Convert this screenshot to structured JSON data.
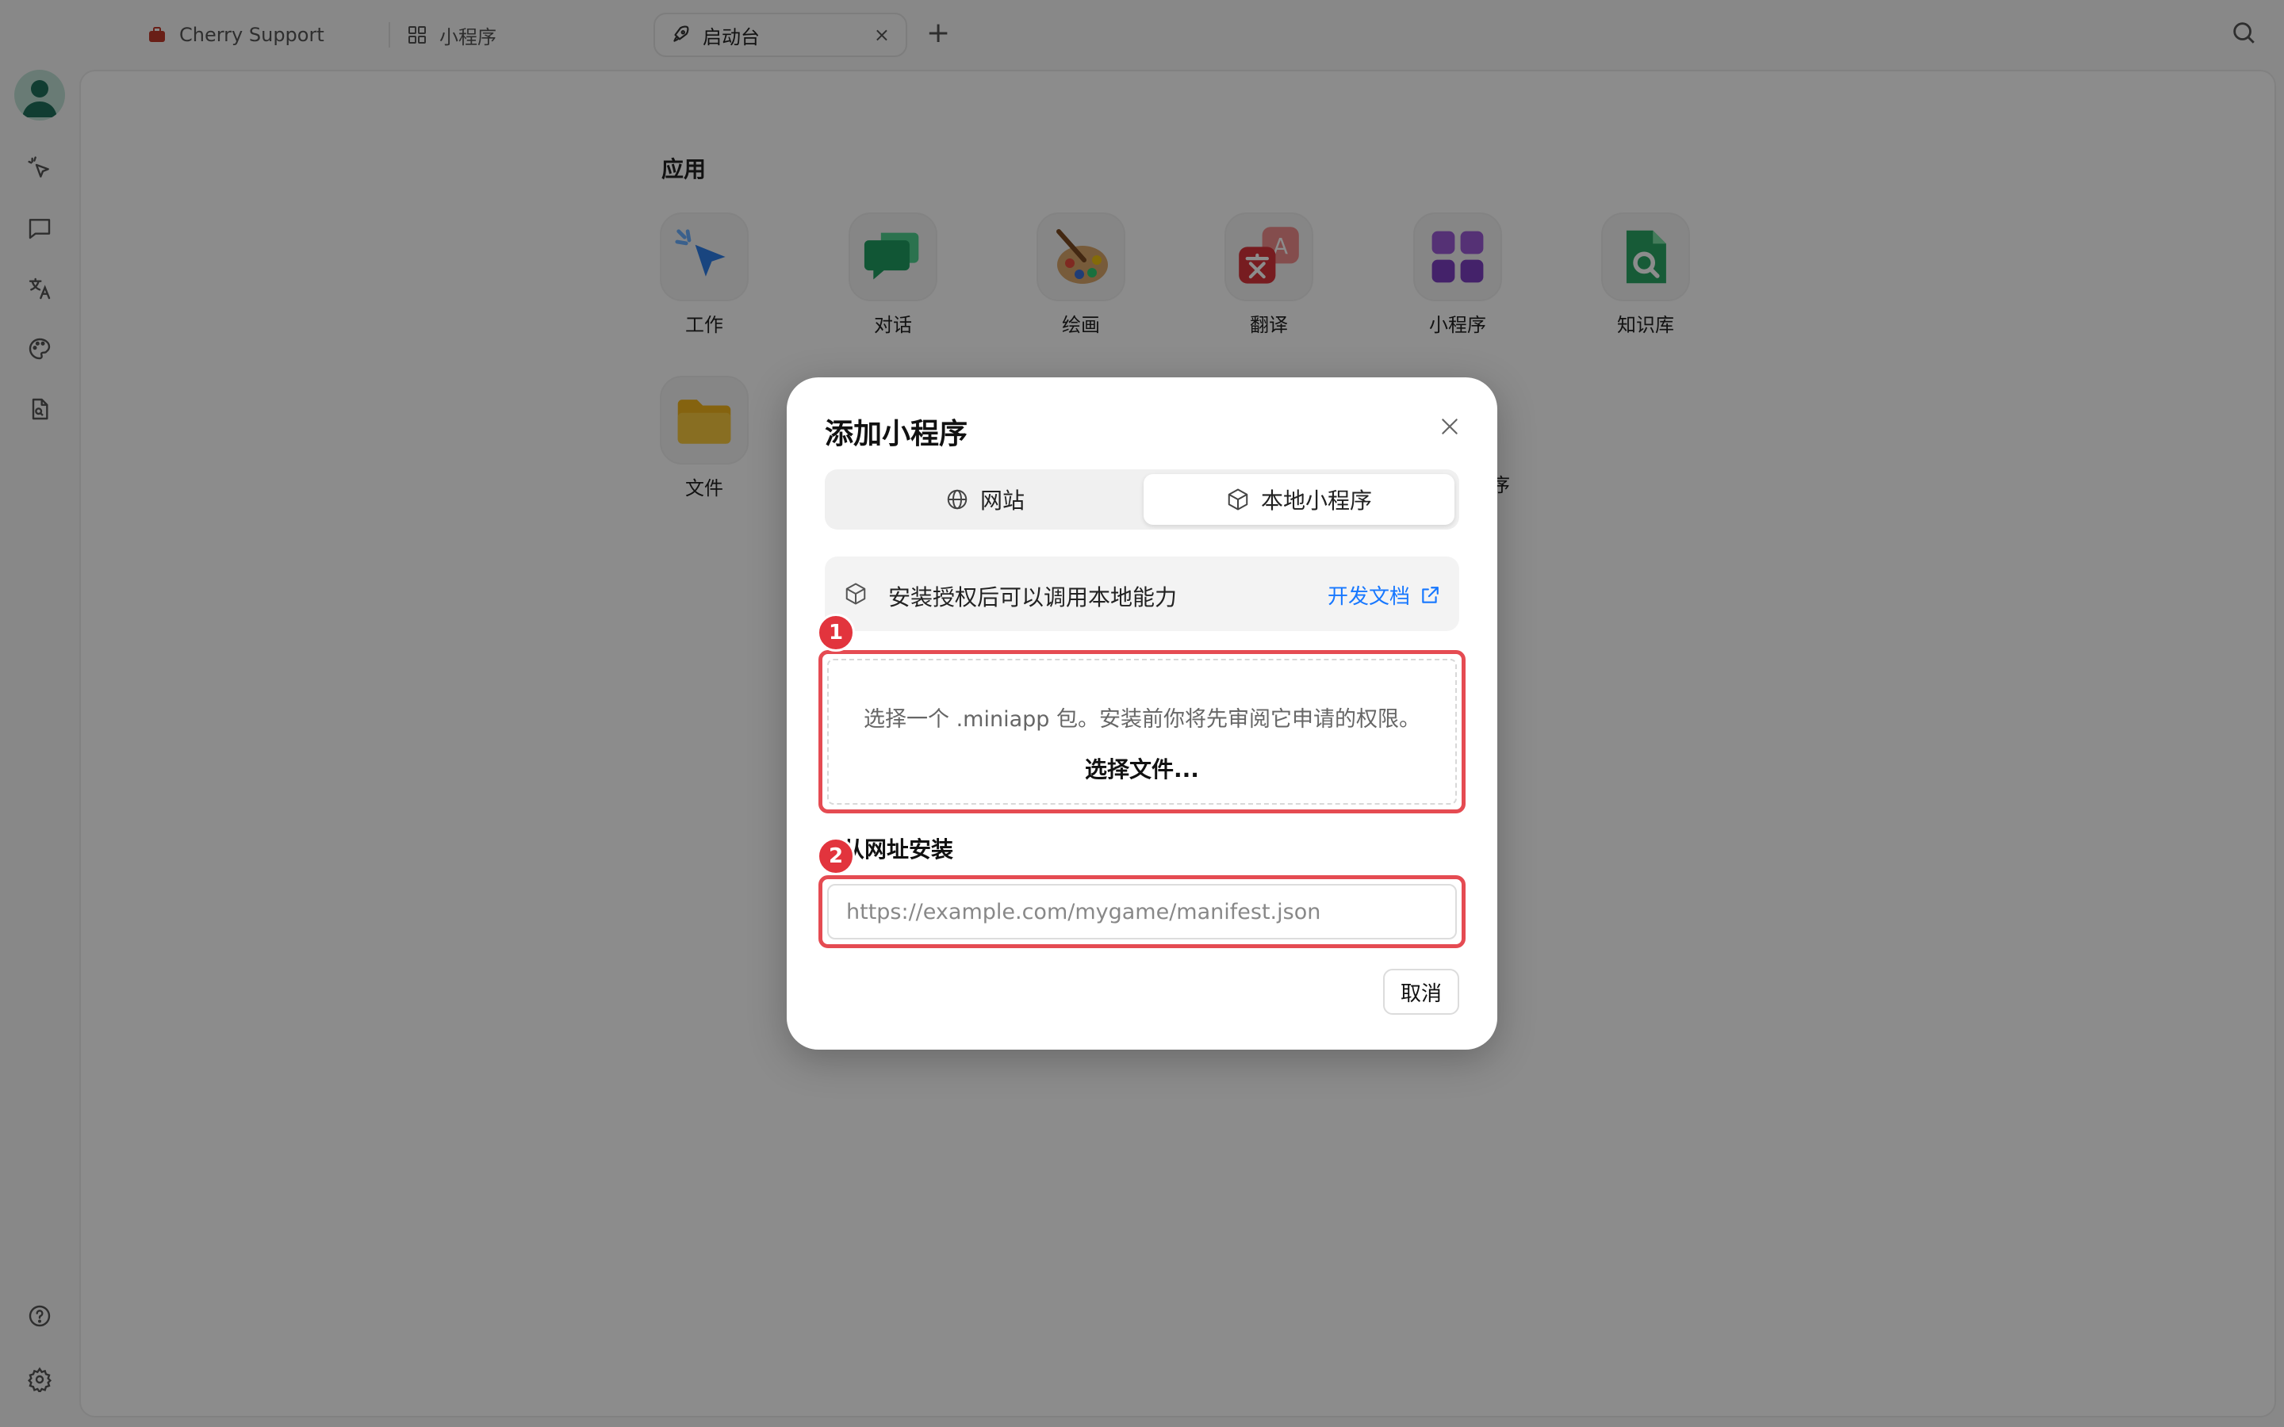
{
  "tabs": [
    {
      "label": "Cherry Support",
      "icon": "briefcase-icon"
    },
    {
      "label": "小程序",
      "icon": "grid-icon"
    },
    {
      "label": "启动台",
      "icon": "rocket-icon",
      "active": true
    }
  ],
  "sidebar": {
    "items": [
      "cursor-sparkle-icon",
      "chat-icon",
      "translate-icon",
      "palette-icon",
      "file-search-icon"
    ],
    "bottom": [
      "help-icon",
      "settings-icon"
    ]
  },
  "launchpad": {
    "section_title": "应用",
    "apps": [
      {
        "label": "工作"
      },
      {
        "label": "对话"
      },
      {
        "label": "绘画"
      },
      {
        "label": "翻译"
      },
      {
        "label": "小程序"
      },
      {
        "label": "知识库"
      },
      {
        "label": "文件"
      }
    ],
    "partial_label": "序"
  },
  "modal": {
    "title": "添加小程序",
    "tabs": {
      "web": "网站",
      "local": "本地小程序"
    },
    "info_text": "安装授权后可以调用本地能力",
    "info_link": "开发文档",
    "dropzone_hint": "选择一个 .miniapp 包。安装前你将先审阅它申请的权限。",
    "dropzone_button": "选择文件...",
    "url_label": "从网址安装",
    "url_placeholder": "https://example.com/mygame/manifest.json",
    "cancel": "取消"
  },
  "badges": {
    "first": "1",
    "second": "2"
  },
  "colors": {
    "accent": "#1677ff",
    "highlight": "#e54b52",
    "badge": "#e2343d"
  }
}
